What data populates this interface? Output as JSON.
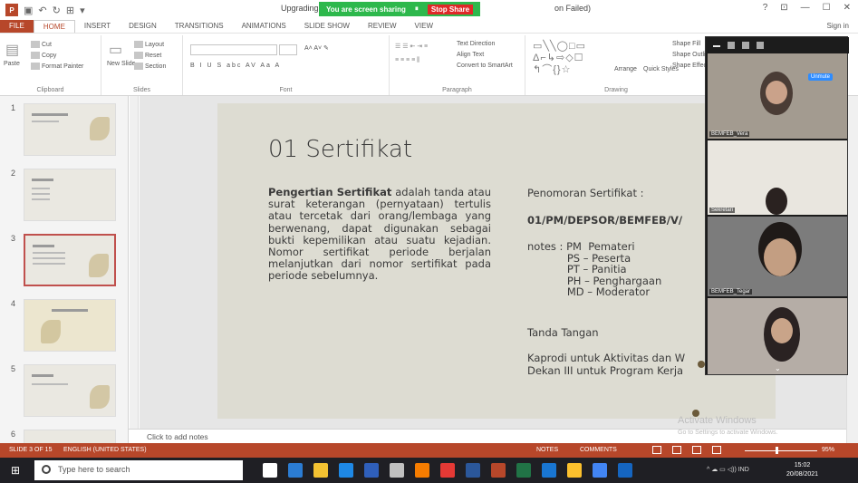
{
  "window": {
    "doc_title": "Upgrading Ka",
    "doc_title_suffix": "on Failed)",
    "sharing_text": "You are screen sharing",
    "stop_share_label": "Stop Share",
    "controls": [
      "?",
      "⊡",
      "—",
      "☐",
      "✕"
    ]
  },
  "ribbon": {
    "tabs": [
      "FILE",
      "HOME",
      "INSERT",
      "DESIGN",
      "TRANSITIONS",
      "ANIMATIONS",
      "SLIDE SHOW",
      "REVIEW",
      "VIEW"
    ],
    "active_tab": "HOME",
    "sign_in": "Sign in",
    "clipboard": {
      "paste": "Paste",
      "cut": "Cut",
      "copy": "Copy",
      "format_painter": "Format Painter",
      "label": "Clipboard"
    },
    "slides": {
      "new_slide": "New Slide",
      "layout": "Layout",
      "reset": "Reset",
      "section": "Section",
      "label": "Slides"
    },
    "font": {
      "label": "Font",
      "row2": "B  I  U  S  abc  AV  Aa  A"
    },
    "paragraph": {
      "label": "Paragraph",
      "text_direction": "Text Direction",
      "align_text": "Align Text",
      "convert_smartart": "Convert to SmartArt"
    },
    "drawing": {
      "arrange": "Arrange",
      "quick_styles": "Quick Styles",
      "shape_fill": "Shape Fill",
      "shape_outline": "Shape Outline",
      "shape_effects": "Shape Effects",
      "label": "Drawing",
      "shapes_glyphs": "▭╲╲◯□▭\nΔ⌐↳⇨◇☐\n↰⌒{}☆"
    }
  },
  "thumbnails": [
    {
      "num": "1",
      "selected": false
    },
    {
      "num": "2",
      "selected": false
    },
    {
      "num": "3",
      "selected": true
    },
    {
      "num": "4",
      "selected": false
    },
    {
      "num": "5",
      "selected": false
    },
    {
      "num": "6",
      "selected": false
    }
  ],
  "slide": {
    "title": "01 Sertifikat",
    "body_bold": "Pengertian Sertifikat",
    "body_rest": " adalah tanda atau surat keterangan (pernyataan) tertulis atau tercetak dari orang/lembaga yang berwenang, dapat digunakan sebagai bukti kepemilikan atau suatu kejadian. Nomor sertifikat periode berjalan melanjutkan dari nomor sertifikat pada periode sebelumnya.",
    "numbering_label": "Penomoran Sertifikat :",
    "numbering_value": "01/PM/DEPSOR/BEMFEB/V/",
    "notes_text": "notes : PM  Pemateri\n            PS – Peserta\n            PT – Panitia\n            PH – Penghargaan\n            MD – Moderator",
    "signature_label": "Tanda Tangan",
    "signature_line1": "Kaprodi untuk Aktivitas dan W",
    "signature_line2": "Dekan III untuk Program Kerja"
  },
  "notes_placeholder": "Click to add notes",
  "watermark": {
    "title": "Activate Windows",
    "subtitle": "Go to Settings to activate Windows."
  },
  "statusbar": {
    "slide_of": "SLIDE 3 OF 15",
    "language": "ENGLISH (UNITED STATES)",
    "notes": "NOTES",
    "comments": "COMMENTS",
    "zoom": "95%",
    "zoom_fraction": 0.42
  },
  "taskbar": {
    "search_placeholder": "Type here to search",
    "tray_text": "^  ☁  ▭  ◁))  IND",
    "time": "15:02",
    "date": "20/08/2021",
    "apps": [
      {
        "color": "#ffffff"
      },
      {
        "color": "#2b7cd3"
      },
      {
        "color": "#f3c232"
      },
      {
        "color": "#1e88e5"
      },
      {
        "color": "#2f5fba"
      },
      {
        "color": "#c0c0c0"
      },
      {
        "color": "#f57c00"
      },
      {
        "color": "#e53935"
      },
      {
        "color": "#2b579a"
      },
      {
        "color": "#b7472a"
      },
      {
        "color": "#217346"
      },
      {
        "color": "#1976d2"
      },
      {
        "color": "#fbc02d"
      },
      {
        "color": "#4285f4"
      },
      {
        "color": "#1565c0"
      }
    ]
  },
  "zoom_meeting": {
    "unmute_label": "Unmute",
    "participants": [
      {
        "name": "BEMFEB_Vera"
      },
      {
        "name": "Sekretari"
      },
      {
        "name": "BEMFEB_Tegar"
      },
      {
        "name": ""
      }
    ]
  },
  "colors": {
    "accent": "#b7472a",
    "share_green": "#2db84c",
    "stop_red": "#e02828",
    "slide_bg": "#dddcd2"
  }
}
